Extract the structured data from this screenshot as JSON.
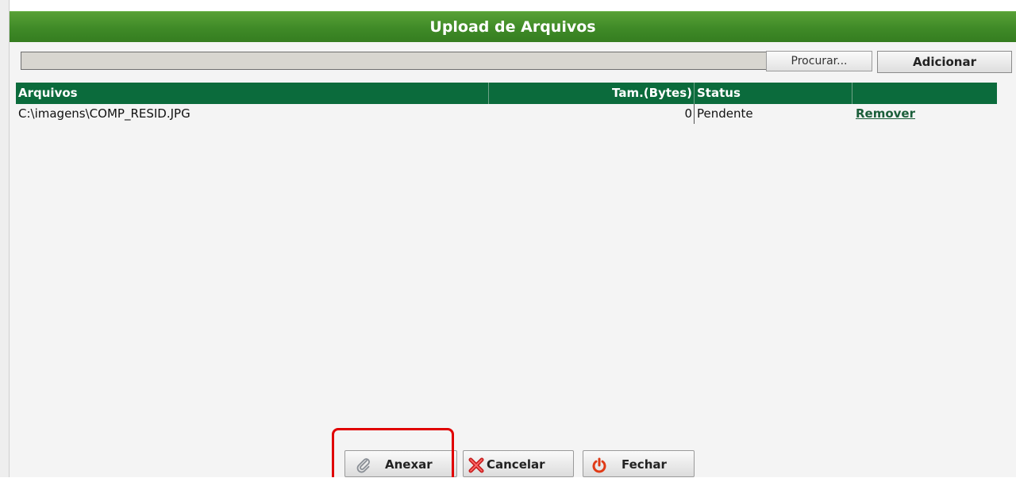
{
  "dialog": {
    "title": "Upload de Arquivos"
  },
  "file_picker": {
    "path_value": "",
    "browse_label": "Procurar...",
    "add_label": "Adicionar"
  },
  "table": {
    "headers": {
      "files": "Arquivos",
      "size": "Tam.(Bytes)",
      "status": "Status"
    },
    "rows": [
      {
        "file": "C:\\imagens\\COMP_RESID.JPG",
        "size": "0",
        "status": "Pendente",
        "action": "Remover"
      }
    ]
  },
  "buttons": {
    "attach_label": "Anexar",
    "cancel_label": "Cancelar",
    "close_label": "Fechar"
  },
  "icons": {
    "attach": "paperclip-icon",
    "cancel": "red-x-icon",
    "close": "power-icon"
  },
  "colors": {
    "title_bar": "#3f8a27",
    "table_header": "#0b6b3c",
    "link": "#1b5e3a",
    "highlight": "#e00000"
  }
}
